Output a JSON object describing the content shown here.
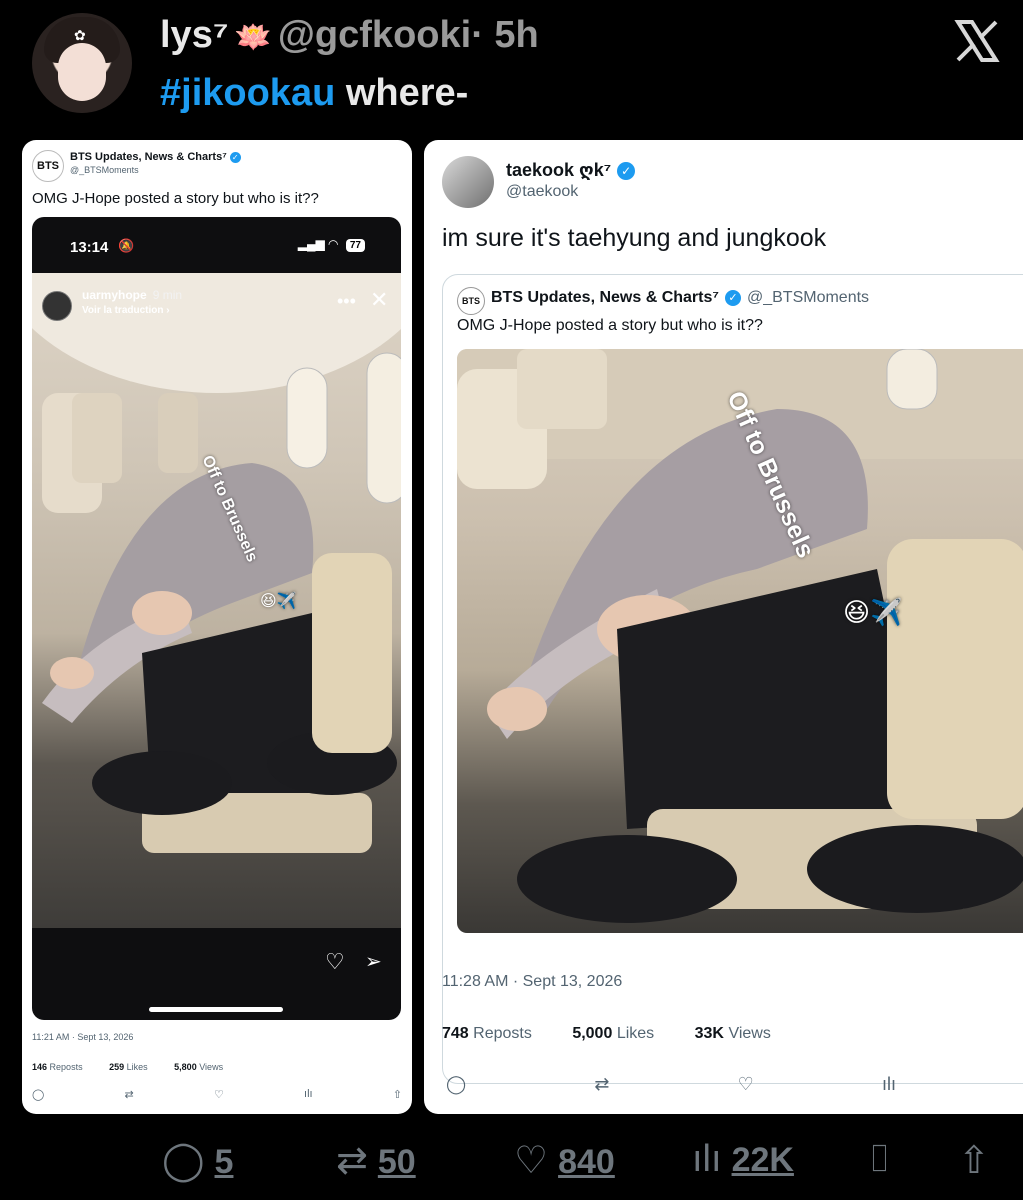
{
  "header": {
    "display_name": "lys⁷",
    "lotus_icon": "🪷",
    "handle": "@gcfkooki",
    "time": "· 5h",
    "hashtag": "#jikookau",
    "text": "where-"
  },
  "left_card": {
    "author": "BTS Updates, News & Charts⁷",
    "handle": "@_BTSMoments",
    "avatar_text": "BTS",
    "text": "OMG J-Hope posted a story but who is it??",
    "phone": {
      "time": "13:14",
      "battery": "77",
      "story_user": "uarmyhope",
      "story_ago": "9 min",
      "translate": "Voir la traduction ›",
      "caption": "Off to Brussels",
      "emoji": "😆✈️"
    },
    "date": "11:21 AM · Sept 13, 2026",
    "reposts": "146",
    "reposts_label": "Reposts",
    "likes": "259",
    "likes_label": "Likes",
    "views": "5,800",
    "views_label": "Views"
  },
  "right_card": {
    "author": "taekook ღk⁷",
    "handle": "@taekook",
    "text": "im sure it's taehyung and jungkook",
    "quote": {
      "author": "BTS Updates, News & Charts⁷",
      "handle": "@_BTSMoments",
      "avatar_text": "BTS",
      "text": "OMG J-Hope posted a story but who is it??",
      "caption": "Off to Brussels",
      "emoji": "😆✈️"
    },
    "date": "11:28 AM · Sept 13, 2026",
    "reposts": "748",
    "reposts_label": "Reposts",
    "likes": "5,000",
    "likes_label": "Likes",
    "views": "33K",
    "views_label": "Views"
  },
  "footer": {
    "replies": "5",
    "reposts": "50",
    "likes": "840",
    "views": "22K"
  },
  "colors": {
    "accent": "#1d9bf0",
    "muted": "#6e767d",
    "background": "#000000"
  },
  "icons": [
    "x-logo-icon",
    "verified-icon",
    "reply-icon",
    "repost-icon",
    "heart-icon",
    "views-icon",
    "bookmark-icon",
    "share-icon",
    "send-icon",
    "more-icon",
    "close-icon",
    "bell-mute-icon"
  ]
}
